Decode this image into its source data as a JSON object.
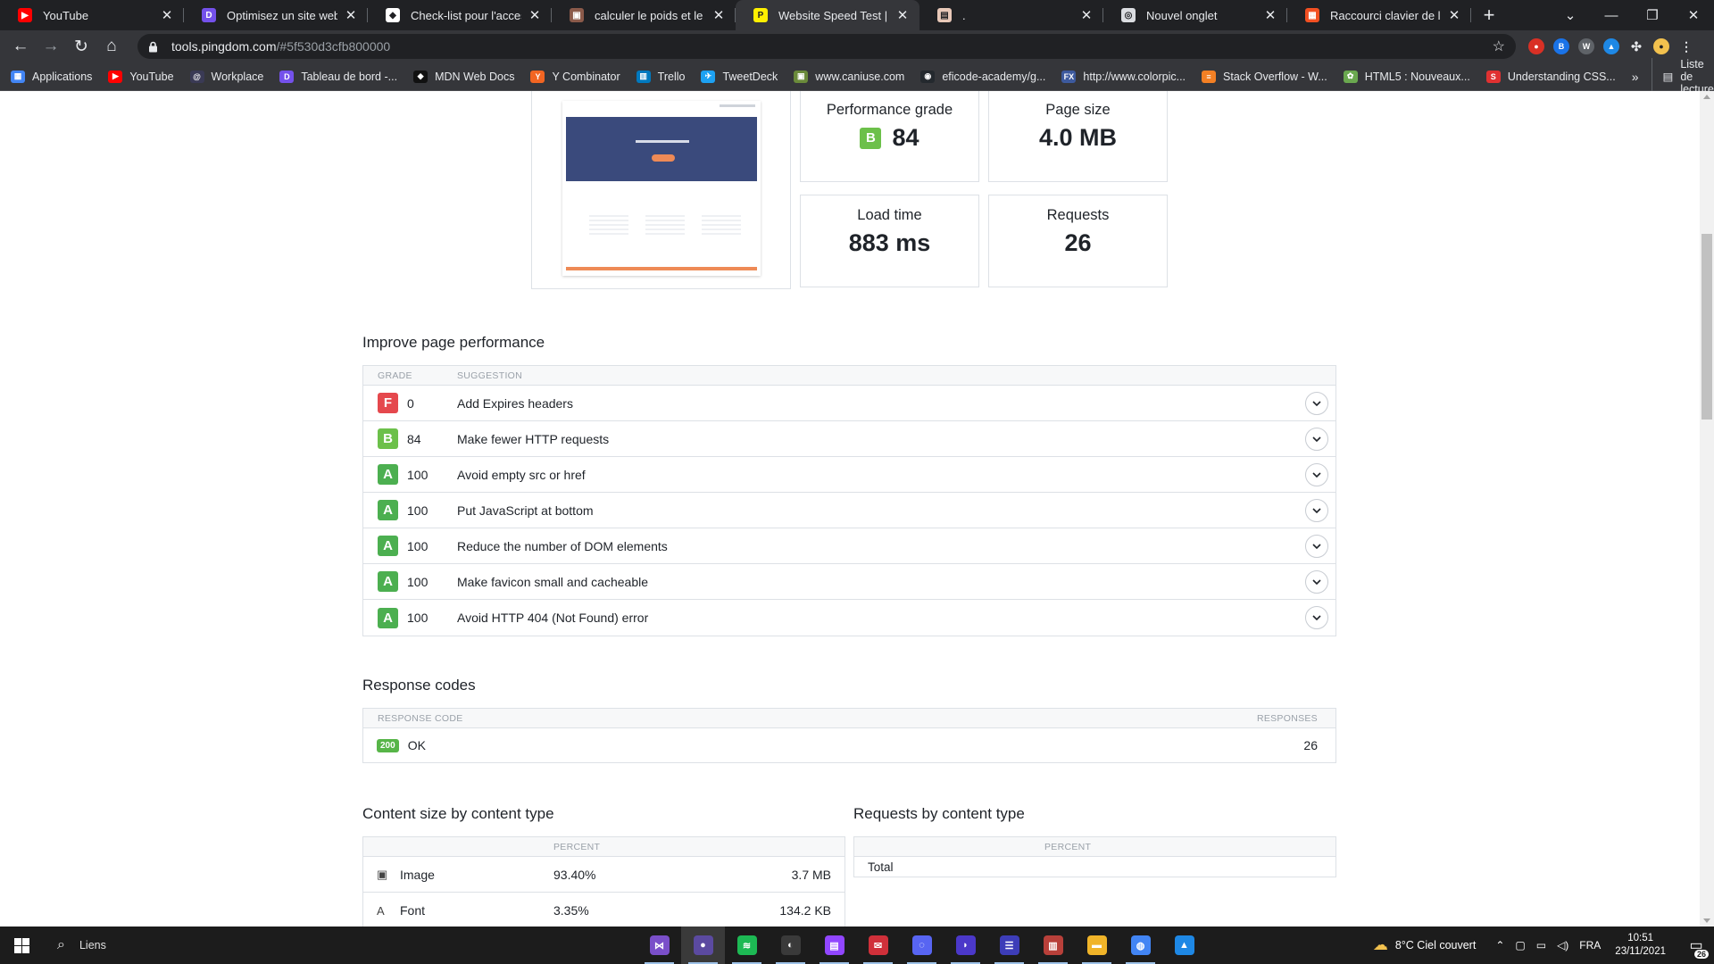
{
  "browser": {
    "tabs": [
      {
        "title": "YouTube",
        "favicon_color": "#ff0000",
        "favicon_text": "▶"
      },
      {
        "title": "Optimisez un site web existant",
        "favicon_color": "#7451eb",
        "favicon_text": "D"
      },
      {
        "title": "Check-list pour l'accessibilité",
        "favicon_color": "#ffffff",
        "favicon_text": "◆"
      },
      {
        "title": "calculer le poids et le temps",
        "favicon_color": "#8b5a4a",
        "favicon_text": "▣"
      },
      {
        "title": "Website Speed Test | Pingdom",
        "favicon_color": "#fff000",
        "favicon_text": "P",
        "active": true
      },
      {
        "title": ".",
        "favicon_color": "#e8c8b8",
        "favicon_text": "▤"
      },
      {
        "title": "Nouvel onglet",
        "favicon_color": "#dadce0",
        "favicon_text": "◎"
      },
      {
        "title": "Raccourci clavier de l'impression",
        "favicon_color": "#f25022",
        "favicon_text": "▦"
      }
    ],
    "url_host": "tools.pingdom.com",
    "url_path": "/#5f530d3cfb800000",
    "bookmarks": [
      {
        "label": "Applications",
        "color": "#4285f4",
        "icon": "▦"
      },
      {
        "label": "YouTube",
        "color": "#ff0000",
        "icon": "▶"
      },
      {
        "label": "Workplace",
        "color": "#3a3a55",
        "icon": "@"
      },
      {
        "label": "Tableau de bord -...",
        "color": "#7451eb",
        "icon": "D"
      },
      {
        "label": "MDN Web Docs",
        "color": "#111111",
        "icon": "◆"
      },
      {
        "label": "Y Combinator",
        "color": "#f26522",
        "icon": "Y"
      },
      {
        "label": "Trello",
        "color": "#0079bf",
        "icon": "▥"
      },
      {
        "label": "TweetDeck",
        "color": "#1da1f2",
        "icon": "✈"
      },
      {
        "label": "www.caniuse.com",
        "color": "#6a8a3a",
        "icon": "▣"
      },
      {
        "label": "eficode-academy/g...",
        "color": "#24292e",
        "icon": "◉"
      },
      {
        "label": "http://www.colorpic...",
        "color": "#3d5a9e",
        "icon": "FX"
      },
      {
        "label": "Stack Overflow - W...",
        "color": "#f48024",
        "icon": "≡"
      },
      {
        "label": "HTML5 : Nouveaux...",
        "color": "#6aa84f",
        "icon": "✿"
      },
      {
        "label": "Understanding CSS...",
        "color": "#e03131",
        "icon": "S"
      }
    ],
    "bookmarks_more": "»",
    "reading_list": "Liste de lecture"
  },
  "summary": {
    "performance_grade": {
      "label": "Performance grade",
      "grade": "B",
      "value": "84",
      "color": "#6cc04a"
    },
    "page_size": {
      "label": "Page size",
      "value": "4.0 MB"
    },
    "load_time": {
      "label": "Load time",
      "value": "883 ms"
    },
    "requests": {
      "label": "Requests",
      "value": "26"
    }
  },
  "improve": {
    "title": "Improve page performance",
    "col_grade": "GRADE",
    "col_suggestion": "SUGGESTION",
    "rows": [
      {
        "grade": "F",
        "score": "0",
        "suggestion": "Add Expires headers",
        "color": "#e5484d"
      },
      {
        "grade": "B",
        "score": "84",
        "suggestion": "Make fewer HTTP requests",
        "color": "#6cc04a"
      },
      {
        "grade": "A",
        "score": "100",
        "suggestion": "Avoid empty src or href",
        "color": "#4caf50"
      },
      {
        "grade": "A",
        "score": "100",
        "suggestion": "Put JavaScript at bottom",
        "color": "#4caf50"
      },
      {
        "grade": "A",
        "score": "100",
        "suggestion": "Reduce the number of DOM elements",
        "color": "#4caf50"
      },
      {
        "grade": "A",
        "score": "100",
        "suggestion": "Make favicon small and cacheable",
        "color": "#4caf50"
      },
      {
        "grade": "A",
        "score": "100",
        "suggestion": "Avoid HTTP 404 (Not Found) error",
        "color": "#4caf50"
      }
    ]
  },
  "response_codes": {
    "title": "Response codes",
    "col_code": "RESPONSE CODE",
    "col_responses": "RESPONSES",
    "rows": [
      {
        "code": "200",
        "label": "OK",
        "responses": "26"
      }
    ]
  },
  "content_size": {
    "title": "Content size by content type",
    "col_percent": "PERCENT",
    "rows": [
      {
        "type": "Image",
        "percent": "93.40%",
        "size": "3.7 MB",
        "icon": "▣"
      },
      {
        "type": "Font",
        "percent": "3.35%",
        "size": "134.2 KB",
        "icon": "A"
      }
    ]
  },
  "requests_by_type": {
    "title": "Requests by content type",
    "col_percent": "PERCENT",
    "rows": [
      {
        "type": "Total"
      }
    ]
  },
  "taskbar": {
    "search_label": "Liens",
    "weather": "8°C  Ciel couvert",
    "language": "FRA",
    "time": "10:51",
    "date": "23/11/2021",
    "notifications": "26",
    "apps": [
      {
        "name": "visual-studio",
        "color": "#7a4fc9",
        "glyph": "⋈"
      },
      {
        "name": "obs",
        "color": "#5b4aa0",
        "glyph": "●"
      },
      {
        "name": "spotify",
        "color": "#1db954",
        "glyph": "≋"
      },
      {
        "name": "obs-studio",
        "color": "#3a3a3a",
        "glyph": "◐"
      },
      {
        "name": "twitch",
        "color": "#9146ff",
        "glyph": "▤"
      },
      {
        "name": "messenger",
        "color": "#d0303a",
        "glyph": "✉"
      },
      {
        "name": "discord",
        "color": "#5865f2",
        "glyph": "◌"
      },
      {
        "name": "notion",
        "color": "#4b38c9",
        "glyph": "◗"
      },
      {
        "name": "tasks",
        "color": "#3d3db8",
        "glyph": "☰"
      },
      {
        "name": "winrar",
        "color": "#b8403a",
        "glyph": "▥"
      },
      {
        "name": "file-explorer",
        "color": "#f0b429",
        "glyph": "▬"
      },
      {
        "name": "chrome",
        "color": "#4285f4",
        "glyph": "◍"
      },
      {
        "name": "photos",
        "color": "#1e88e5",
        "glyph": "▲"
      }
    ]
  }
}
